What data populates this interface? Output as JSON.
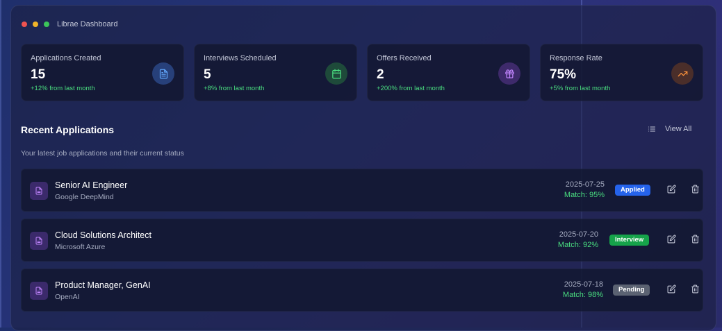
{
  "window": {
    "title": "Librae Dashboard"
  },
  "stats": [
    {
      "label": "Applications Created",
      "value": "15",
      "change": "+12% from last month",
      "icon": "document-icon",
      "icon_color": "#60a5fa",
      "icon_bg": "#27407a"
    },
    {
      "label": "Interviews Scheduled",
      "value": "5",
      "change": "+8% from last month",
      "icon": "calendar-icon",
      "icon_color": "#4ade80",
      "icon_bg": "#1e4a3a"
    },
    {
      "label": "Offers Received",
      "value": "2",
      "change": "+200% from last month",
      "icon": "gift-icon",
      "icon_color": "#c084fc",
      "icon_bg": "#3e2a6b"
    },
    {
      "label": "Response Rate",
      "value": "75%",
      "change": "+5% from last month",
      "icon": "trending-up-icon",
      "icon_color": "#fb923c",
      "icon_bg": "#4a2e2a"
    }
  ],
  "recent": {
    "title": "Recent Applications",
    "subtitle": "Your latest job applications and their current status",
    "view_all_label": "View All",
    "items": [
      {
        "title": "Senior AI Engineer",
        "company": "Google DeepMind",
        "date": "2025-07-25",
        "match": "Match: 95%",
        "status": "Applied"
      },
      {
        "title": "Cloud Solutions Architect",
        "company": "Microsoft Azure",
        "date": "2025-07-20",
        "match": "Match: 92%",
        "status": "Interview"
      },
      {
        "title": "Product Manager, GenAI",
        "company": "OpenAI",
        "date": "2025-07-18",
        "match": "Match: 98%",
        "status": "Pending"
      }
    ]
  },
  "colors": {
    "accent_green": "#4ade80",
    "status_applied": "#2563eb",
    "status_interview": "#16a34a",
    "status_pending": "#5b6272"
  }
}
